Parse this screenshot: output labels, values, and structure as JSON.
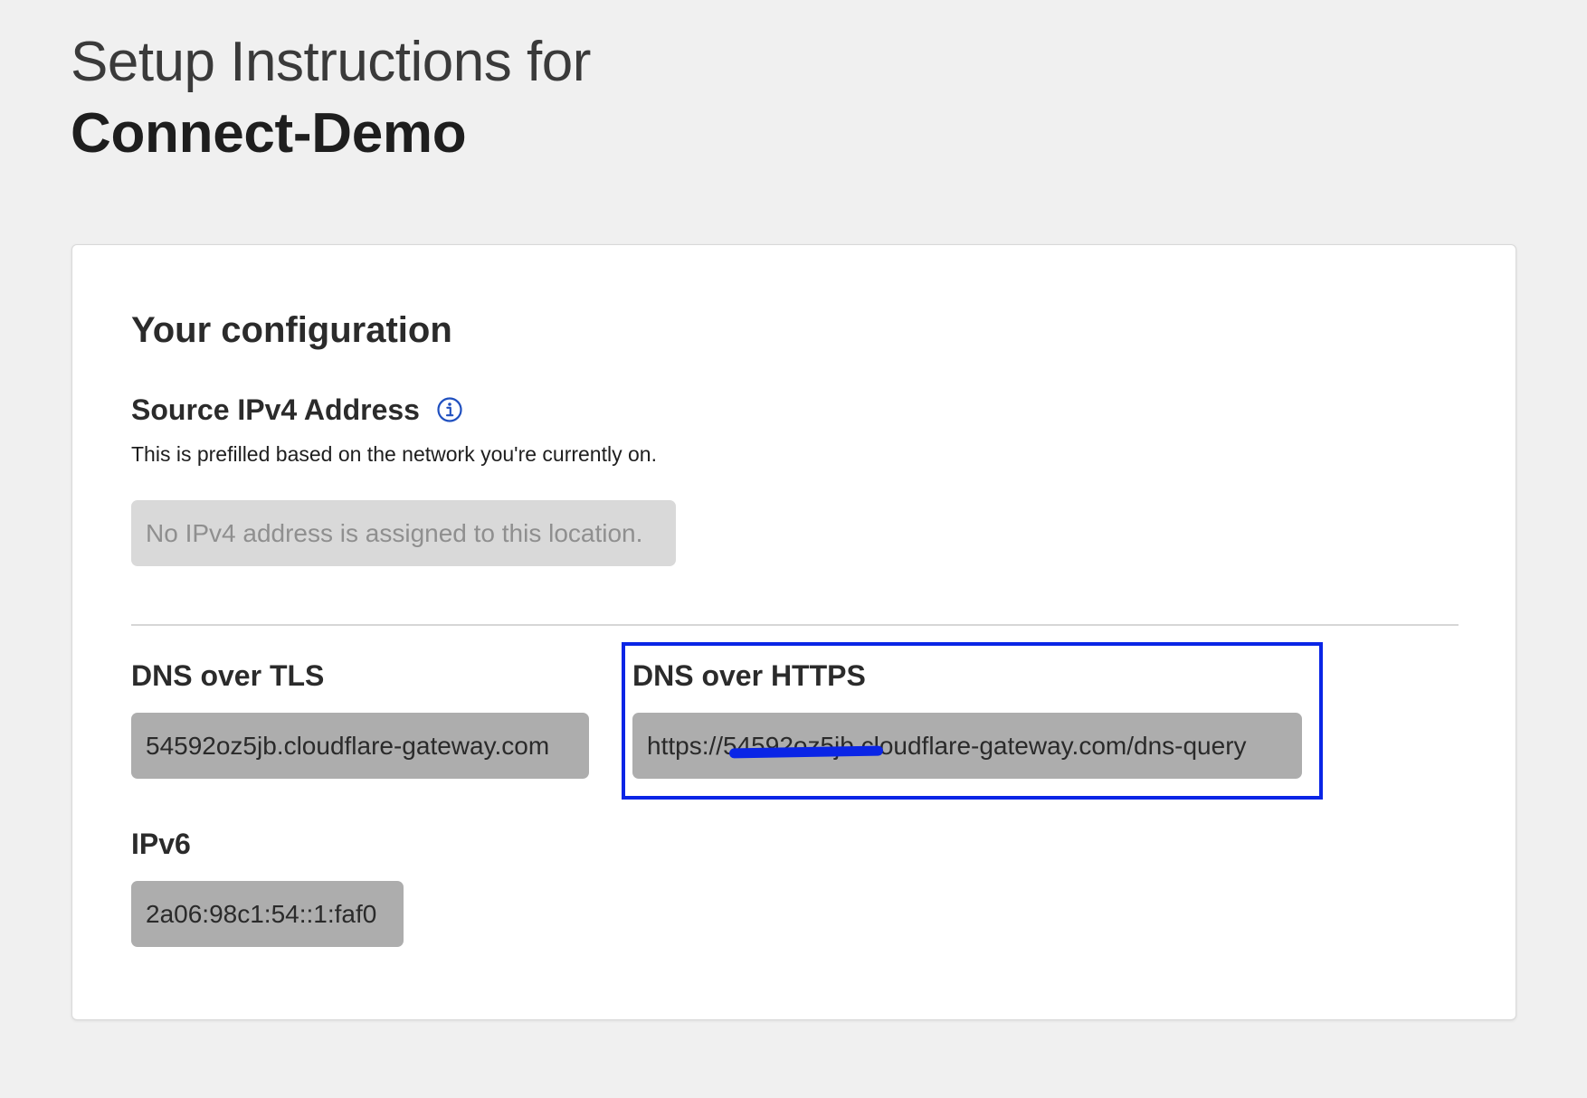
{
  "header": {
    "subtitle": "Setup Instructions for",
    "title": "Connect-Demo"
  },
  "config": {
    "heading": "Your configuration",
    "ipv4": {
      "label": "Source IPv4 Address",
      "help_text": "This is prefilled based on the network you're currently on.",
      "value": "No IPv4 address is assigned to this location."
    },
    "dns_over_tls": {
      "label": "DNS over TLS",
      "value": "54592oz5jb.cloudflare-gateway.com"
    },
    "dns_over_https": {
      "label": "DNS over HTTPS",
      "value": "https://54592oz5jb.cloudflare-gateway.com/dns-query"
    },
    "ipv6": {
      "label": "IPv6",
      "value": "2a06:98c1:54::1:faf0"
    }
  },
  "icons": {
    "info": "info-circle-icon"
  },
  "colors": {
    "background": "#f0f0f0",
    "card": "#ffffff",
    "highlight": "#0a25e6",
    "info_icon": "#1f4fbf",
    "field_disabled": "#d9d9d9",
    "field_readonly": "#adadad"
  }
}
